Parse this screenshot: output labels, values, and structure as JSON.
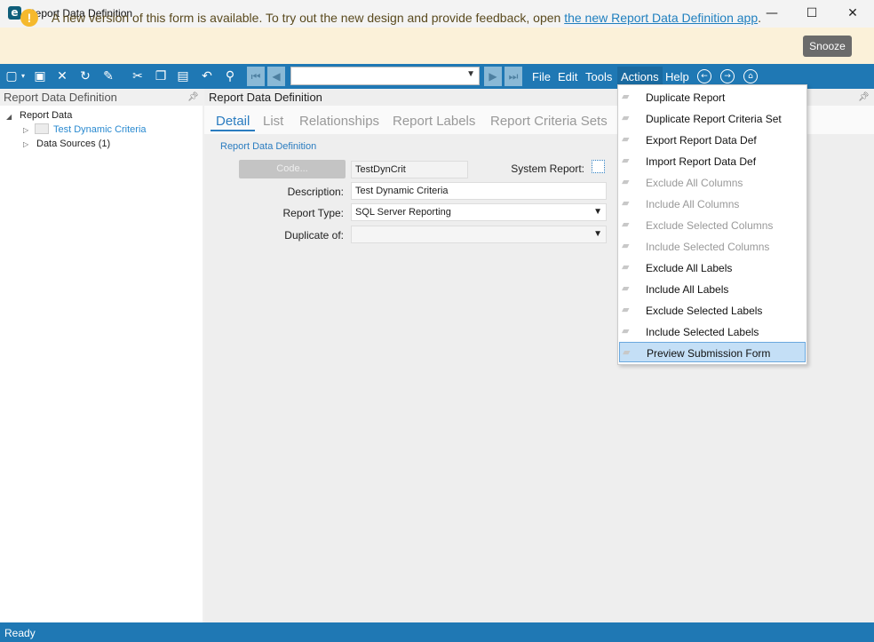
{
  "window": {
    "title": "Report Data Definition",
    "app_icon": "e",
    "minimize": "—",
    "maximize": "☐",
    "close": "✕"
  },
  "banner": {
    "text": "A new version of this form is available. To try out the new design and provide feedback, open ",
    "link": "the new Report Data Definition app",
    "suffix": ".",
    "snooze": "Snooze",
    "icon": "!"
  },
  "toolbar": {
    "icons": [
      "new-icon",
      "save-icon",
      "delete-icon",
      "refresh-icon",
      "clear-icon",
      "cut-icon",
      "copy-icon",
      "paste-icon",
      "undo-icon",
      "find-icon"
    ],
    "menus": [
      "File",
      "Edit",
      "Tools",
      "Actions",
      "Help"
    ],
    "record_value": ""
  },
  "left_panel": {
    "title": "Report Data Definition",
    "tree": {
      "root": "Report Data",
      "items": [
        "Test Dynamic Criteria",
        "Data Sources (1)"
      ]
    }
  },
  "main": {
    "header": "Report Data Definition",
    "tabs": [
      "Detail",
      "List",
      "Relationships",
      "Report Labels",
      "Report Criteria Sets"
    ],
    "active_tab": "Detail",
    "section_label": "Report Data Definition",
    "form": {
      "code_button": "Code...",
      "code_value": "TestDynCrit",
      "system_report_label": "System Report:",
      "description_label": "Description:",
      "description_value": "Test Dynamic Criteria",
      "report_type_label": "Report Type:",
      "report_type_value": "SQL Server Reporting",
      "duplicate_of_label": "Duplicate of:",
      "duplicate_of_value": ""
    }
  },
  "actions_menu": {
    "items": [
      {
        "label": "Duplicate Report",
        "enabled": true
      },
      {
        "label": "Duplicate Report Criteria Set",
        "enabled": true
      },
      {
        "label": "Export Report Data Def",
        "enabled": true
      },
      {
        "label": "Import Report Data Def",
        "enabled": true
      },
      {
        "label": "Exclude All Columns",
        "enabled": false
      },
      {
        "label": "Include All Columns",
        "enabled": false
      },
      {
        "label": "Exclude Selected Columns",
        "enabled": false
      },
      {
        "label": "Include Selected Columns",
        "enabled": false
      },
      {
        "label": "Exclude All Labels",
        "enabled": true
      },
      {
        "label": "Include All Labels",
        "enabled": true
      },
      {
        "label": "Exclude Selected Labels",
        "enabled": true
      },
      {
        "label": "Include Selected Labels",
        "enabled": true
      },
      {
        "label": "Preview Submission Form",
        "enabled": true,
        "highlighted": true
      }
    ]
  },
  "status": {
    "text": "Ready"
  }
}
